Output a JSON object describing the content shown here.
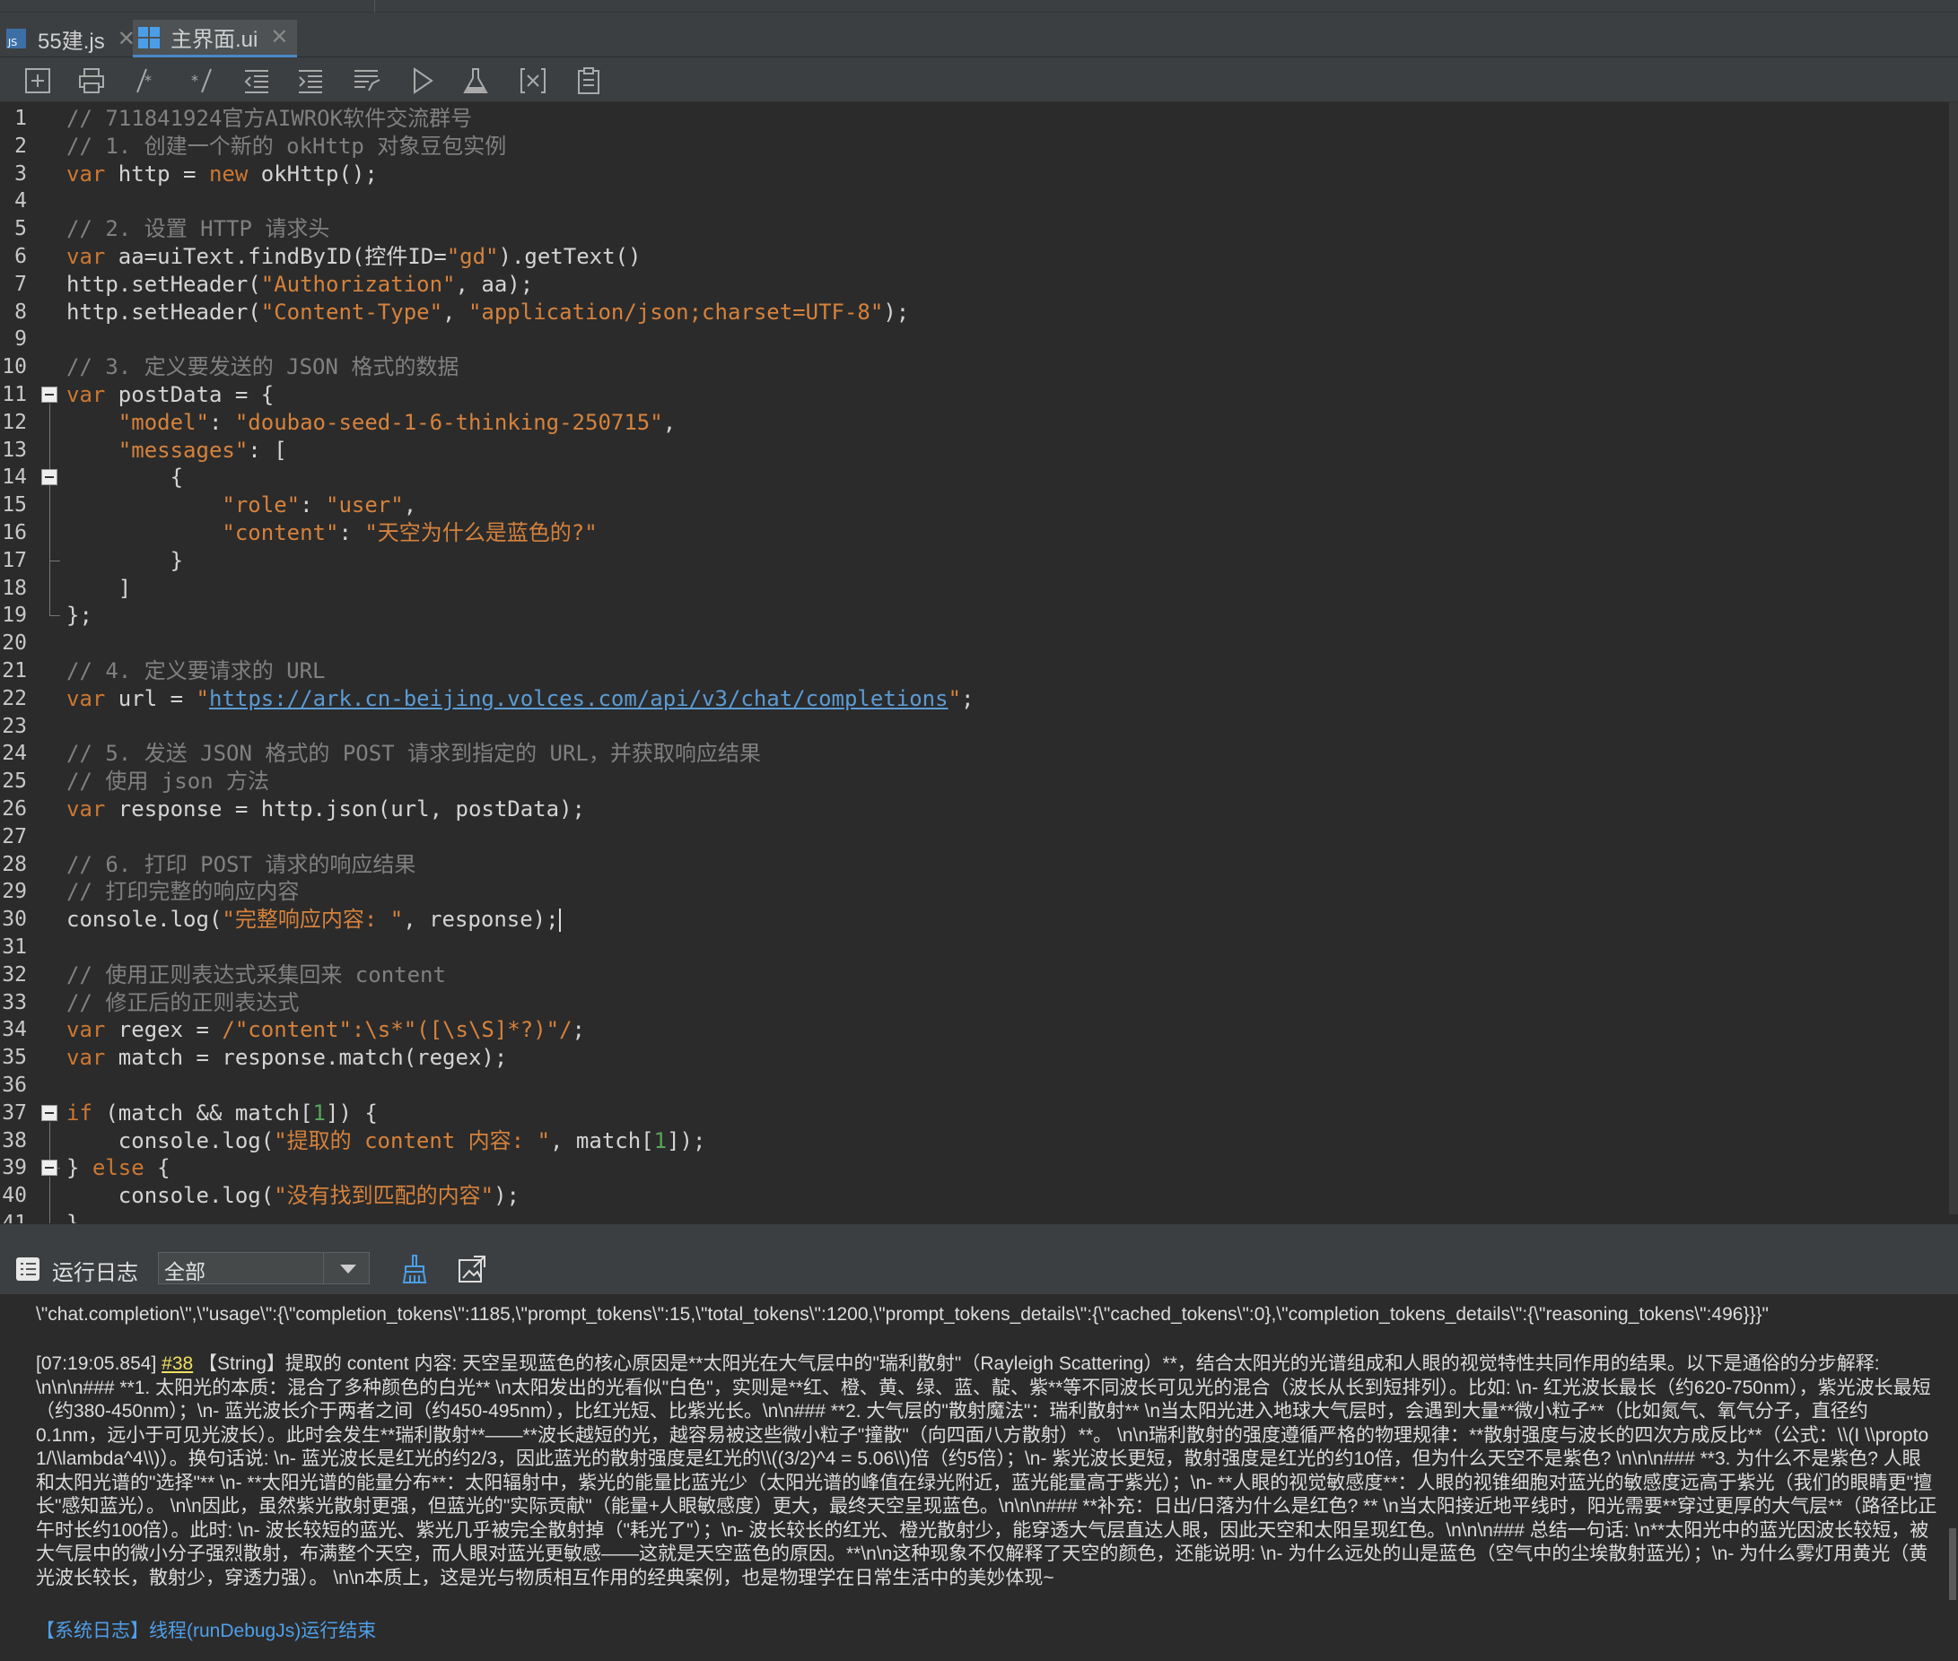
{
  "tabs": [
    {
      "label": "55建.js",
      "icon": "js-file-icon",
      "active": false
    },
    {
      "label": "主界面.ui",
      "icon": "ui-file-icon",
      "active": true
    }
  ],
  "toolbar": {
    "buttons": [
      "add-file-icon",
      "print-icon",
      "comment-icon",
      "uncomment-icon",
      "outdent-icon",
      "indent-icon",
      "format-icon",
      "run-icon",
      "flask-icon",
      "variable-icon",
      "clipboard-icon"
    ]
  },
  "editor": {
    "lines": [
      {
        "n": "1",
        "t": [
          [
            "c",
            "// 711841924官方AIWROK软件交流群号"
          ]
        ]
      },
      {
        "n": "2",
        "t": [
          [
            "c",
            "// 1. 创建一个新的 okHttp 对象豆包实例"
          ]
        ]
      },
      {
        "n": "3",
        "t": [
          [
            "k",
            "var"
          ],
          [
            "p",
            " http = "
          ],
          [
            "k",
            "new"
          ],
          [
            "p",
            " okHttp();"
          ]
        ]
      },
      {
        "n": "4",
        "t": []
      },
      {
        "n": "5",
        "t": [
          [
            "c",
            "// 2. 设置 HTTP 请求头"
          ]
        ]
      },
      {
        "n": "6",
        "t": [
          [
            "k",
            "var"
          ],
          [
            "p",
            " aa=uiText.findByID(控件ID="
          ],
          [
            "s",
            "\"gd\""
          ],
          [
            "p",
            ").getText()"
          ]
        ]
      },
      {
        "n": "7",
        "t": [
          [
            "p",
            "http.setHeader("
          ],
          [
            "s",
            "\"Authorization\""
          ],
          [
            "p",
            ", aa);"
          ]
        ]
      },
      {
        "n": "8",
        "t": [
          [
            "p",
            "http.setHeader("
          ],
          [
            "s",
            "\"Content-Type\""
          ],
          [
            "p",
            ", "
          ],
          [
            "s",
            "\"application/json;charset=UTF-8\""
          ],
          [
            "p",
            ");"
          ]
        ]
      },
      {
        "n": "9",
        "t": []
      },
      {
        "n": "10",
        "t": [
          [
            "c",
            "// 3. 定义要发送的 JSON 格式的数据"
          ]
        ]
      },
      {
        "n": "11",
        "t": [
          [
            "k",
            "var"
          ],
          [
            "p",
            " postData = {"
          ]
        ]
      },
      {
        "n": "12",
        "t": [
          [
            "p",
            "    "
          ],
          [
            "s",
            "\"model\""
          ],
          [
            "p",
            ": "
          ],
          [
            "s",
            "\"doubao-seed-1-6-thinking-250715\""
          ],
          [
            "p",
            ","
          ]
        ]
      },
      {
        "n": "13",
        "t": [
          [
            "p",
            "    "
          ],
          [
            "s",
            "\"messages\""
          ],
          [
            "p",
            ": ["
          ]
        ]
      },
      {
        "n": "14",
        "t": [
          [
            "p",
            "        {"
          ]
        ]
      },
      {
        "n": "15",
        "t": [
          [
            "p",
            "            "
          ],
          [
            "s",
            "\"role\""
          ],
          [
            "p",
            ": "
          ],
          [
            "s",
            "\"user\""
          ],
          [
            "p",
            ","
          ]
        ]
      },
      {
        "n": "16",
        "t": [
          [
            "p",
            "            "
          ],
          [
            "s",
            "\"content\""
          ],
          [
            "p",
            ": "
          ],
          [
            "s",
            "\"天空为什么是蓝色的?\""
          ]
        ]
      },
      {
        "n": "17",
        "t": [
          [
            "p",
            "        }"
          ]
        ]
      },
      {
        "n": "18",
        "t": [
          [
            "p",
            "    ]"
          ]
        ]
      },
      {
        "n": "19",
        "t": [
          [
            "p",
            "};"
          ]
        ]
      },
      {
        "n": "20",
        "t": []
      },
      {
        "n": "21",
        "t": [
          [
            "c",
            "// 4. 定义要请求的 URL"
          ]
        ]
      },
      {
        "n": "22",
        "t": [
          [
            "k",
            "var"
          ],
          [
            "p",
            " url = "
          ],
          [
            "s",
            "\""
          ],
          [
            "u",
            "https://ark.cn-beijing.volces.com/api/v3/chat/completions"
          ],
          [
            "s",
            "\""
          ],
          [
            "p",
            ";"
          ]
        ]
      },
      {
        "n": "23",
        "t": []
      },
      {
        "n": "24",
        "t": [
          [
            "c",
            "// 5. 发送 JSON 格式的 POST 请求到指定的 URL，并获取响应结果"
          ]
        ]
      },
      {
        "n": "25",
        "t": [
          [
            "c",
            "// 使用 json 方法"
          ]
        ]
      },
      {
        "n": "26",
        "t": [
          [
            "k",
            "var"
          ],
          [
            "p",
            " response = http.json(url, postData);"
          ]
        ]
      },
      {
        "n": "27",
        "t": []
      },
      {
        "n": "28",
        "t": [
          [
            "c",
            "// 6. 打印 POST 请求的响应结果"
          ]
        ]
      },
      {
        "n": "29",
        "t": [
          [
            "c",
            "// 打印完整的响应内容"
          ]
        ]
      },
      {
        "n": "30",
        "t": [
          [
            "p",
            "console.log("
          ],
          [
            "s",
            "\"完整响应内容: \""
          ],
          [
            "p",
            ", response);"
          ]
        ]
      },
      {
        "n": "31",
        "t": []
      },
      {
        "n": "32",
        "t": [
          [
            "c",
            "// 使用正则表达式采集回来 content"
          ]
        ]
      },
      {
        "n": "33",
        "t": [
          [
            "c",
            "// 修正后的正则表达式"
          ]
        ]
      },
      {
        "n": "34",
        "t": [
          [
            "k",
            "var"
          ],
          [
            "p",
            " regex = "
          ],
          [
            "s",
            "/\"content\":\\s*\"([\\s\\S]*?)\"/"
          ],
          [
            "p",
            ";"
          ]
        ]
      },
      {
        "n": "35",
        "t": [
          [
            "k",
            "var"
          ],
          [
            "p",
            " match = response.match(regex);"
          ]
        ]
      },
      {
        "n": "36",
        "t": []
      },
      {
        "n": "37",
        "t": [
          [
            "k",
            "if"
          ],
          [
            "p",
            " (match && match["
          ],
          [
            "n",
            "1"
          ],
          [
            "p",
            "]) {"
          ]
        ]
      },
      {
        "n": "38",
        "t": [
          [
            "p",
            "    console.log("
          ],
          [
            "s",
            "\"提取的 content 内容: \""
          ],
          [
            "p",
            ", match["
          ],
          [
            "n",
            "1"
          ],
          [
            "p",
            "]);"
          ]
        ]
      },
      {
        "n": "39",
        "t": [
          [
            "p",
            "} "
          ],
          [
            "k",
            "else"
          ],
          [
            "p",
            " {"
          ]
        ]
      },
      {
        "n": "40",
        "t": [
          [
            "p",
            "    console.log("
          ],
          [
            "s",
            "\"没有找到匹配的内容\""
          ],
          [
            "p",
            ");"
          ]
        ]
      },
      {
        "n": "41",
        "t": [
          [
            "p",
            "}"
          ]
        ]
      }
    ]
  },
  "log": {
    "title": "运行日志",
    "filter": "全部",
    "line1": "\\\"chat.completion\\\",\\\"usage\\\":{\\\"completion_tokens\\\":1185,\\\"prompt_tokens\\\":15,\\\"total_tokens\\\":1200,\\\"prompt_tokens_details\\\":{\\\"cached_tokens\\\":0},\\\"completion_tokens_details\\\":{\\\"reasoning_tokens\\\":496}}}\"",
    "entry_time": "[07:19:05.854]",
    "entry_link": "#38",
    "entry_text": "【String】提取的 content 内容:  天空呈现蓝色的核心原因是**太阳光在大气层中的\"瑞利散射\"（Rayleigh Scattering）**，结合太阳光的光谱组成和人眼的视觉特性共同作用的结果。以下是通俗的分步解释: \\n\\n\\n### **1. 太阳光的本质：混合了多种颜色的白光** \\n太阳发出的光看似\"白色\"，实则是**红、橙、黄、绿、蓝、靛、紫**等不同波长可见光的混合（波长从长到短排列）。比如: \\n- 红光波长最长（约620-750nm），紫光波长最短（约380-450nm）；\\n- 蓝光波长介于两者之间（约450-495nm），比红光短、比紫光长。\\n\\n### **2. 大气层的\"散射魔法\"：瑞利散射** \\n当太阳光进入地球大气层时，会遇到大量**微小粒子**（比如氮气、氧气分子，直径约0.1nm，远小于可见光波长）。此时会发生**瑞利散射**——**波长越短的光，越容易被这些微小粒子\"撞散\"（向四面八方散射）**。 \\n\\n瑞利散射的强度遵循严格的物理规律：**散射强度与波长的四次方成反比**（公式：\\\\(I \\\\propto 1/\\\\lambda^4\\\\)）。换句话说: \\n- 蓝光波长是红光的约2/3，因此蓝光的散射强度是红光的\\\\((3/2)^4 = 5.06\\\\)倍（约5倍）；\\n- 紫光波长更短，散射强度是红光的约10倍，但为什么天空不是紫色? \\n\\n\\n### **3. 为什么不是紫色? 人眼和太阳光谱的\"选择\"** \\n- **太阳光谱的能量分布**：太阳辐射中，紫光的能量比蓝光少（太阳光谱的峰值在绿光附近，蓝光能量高于紫光）；\\n- **人眼的视觉敏感度**：人眼的视锥细胞对蓝光的敏感度远高于紫光（我们的眼睛更\"擅长\"感知蓝光）。 \\n\\n因此，虽然紫光散射更强，但蓝光的\"实际贡献\"（能量+人眼敏感度）更大，最终天空呈现蓝色。\\n\\n\\n### **补充：日出/日落为什么是红色? ** \\n当太阳接近地平线时，阳光需要**穿过更厚的大气层**（路径比正午时长约100倍）。此时: \\n- 波长较短的蓝光、紫光几乎被完全散射掉（\"耗光了\"）；\\n- 波长较长的红光、橙光散射少，能穿透大气层直达人眼，因此天空和太阳呈现红色。\\n\\n\\n### 总结一句话: \\n**太阳光中的蓝光因波长较短，被大气层中的微小分子强烈散射，布满整个天空，而人眼对蓝光更敏感——这就是天空蓝色的原因。**\\n\\n这种现象不仅解释了天空的颜色，还能说明: \\n- 为什么远处的山是蓝色（空气中的尘埃散射蓝光）；\\n- 为什么雾灯用黄光（黄光波长较长，散射少，穿透力强）。 \\n\\n本质上，这是光与物质相互作用的经典案例，也是物理学在日常生活中的美妙体现~",
    "system": "【系统日志】线程(runDebugJs)运行结束"
  }
}
